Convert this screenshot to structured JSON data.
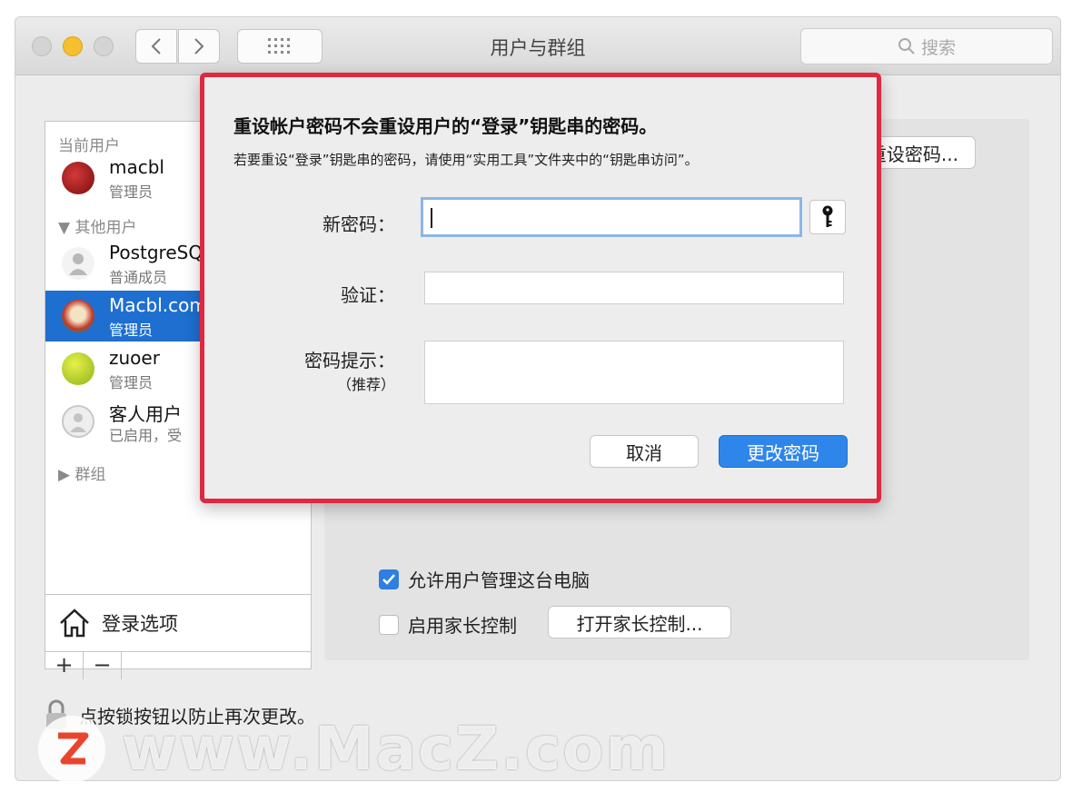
{
  "window": {
    "title": "用户与群组"
  },
  "search": {
    "placeholder": "搜索"
  },
  "sidebar": {
    "current_header": "当前用户",
    "current_user": {
      "name": "macbl",
      "role": "管理员"
    },
    "others_header": "其他用户",
    "users": [
      {
        "name": "PostgreSQ",
        "role": "普通成员",
        "selected": false
      },
      {
        "name": "Macbl.com",
        "role": "管理员",
        "selected": true
      },
      {
        "name": "zuoer",
        "role": "管理员",
        "selected": false
      },
      {
        "name": "客人用户",
        "role": "已启用，受",
        "selected": false
      }
    ],
    "groups_header": "群组",
    "login_options": "登录选项",
    "add": "+",
    "remove": "−"
  },
  "main": {
    "reset_password": "重设密码...",
    "allow_admin": {
      "label": "允许用户管理这台电脑",
      "checked": true
    },
    "parental": {
      "label": "启用家长控制",
      "checked": false
    },
    "open_parental": "打开家长控制...",
    "lock_text": "点按锁按钮以防止再次更改。"
  },
  "dialog": {
    "title": "重设帐户密码不会重设用户的“登录”钥匙串的密码。",
    "subtitle": "若要重设“登录”钥匙串的密码，请使用“实用工具”文件夹中的“钥匙串访问”。",
    "new_password_label": "新密码：",
    "verify_label": "验证：",
    "hint_label": "密码提示：",
    "hint_note": "（推荐）",
    "new_password_value": "",
    "verify_value": "",
    "hint_value": "",
    "cancel": "取消",
    "confirm": "更改密码"
  },
  "watermark": {
    "text": "www.MacZ.com",
    "logo_letter": "Z"
  },
  "colors": {
    "accent": "#2f86ea",
    "selection": "#1e6fd0",
    "highlight_border": "#e0283e"
  }
}
